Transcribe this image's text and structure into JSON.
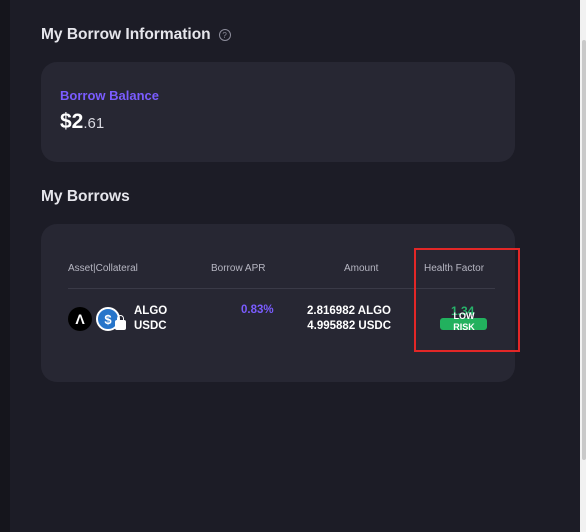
{
  "borrow_info": {
    "title": "My Borrow Information",
    "help_glyph": "?",
    "balance_label": "Borrow Balance",
    "balance_int": "$2",
    "balance_dec": ".61"
  },
  "borrows": {
    "title": "My Borrows",
    "headers": {
      "asset": "Asset|Collateral",
      "apr": "Borrow APR",
      "amount": "Amount",
      "health": "Health Factor"
    },
    "rows": [
      {
        "icon_primary": "algo-logo",
        "icon_primary_glyph": "Λ",
        "icon_secondary": "usdc-logo",
        "icon_secondary_glyph": "$",
        "asset_1": "ALGO",
        "asset_2": "USDC",
        "apr": "0.83%",
        "amount_1": "2.816982 ALGO",
        "amount_2": "4.995882 USDC",
        "health_factor": "1.34",
        "risk_line1": "LOW",
        "risk_line2": "RISK"
      }
    ]
  },
  "colors": {
    "accent_purple": "#7a5cff",
    "health_green": "#22b15e",
    "highlight_red": "#e22727"
  }
}
